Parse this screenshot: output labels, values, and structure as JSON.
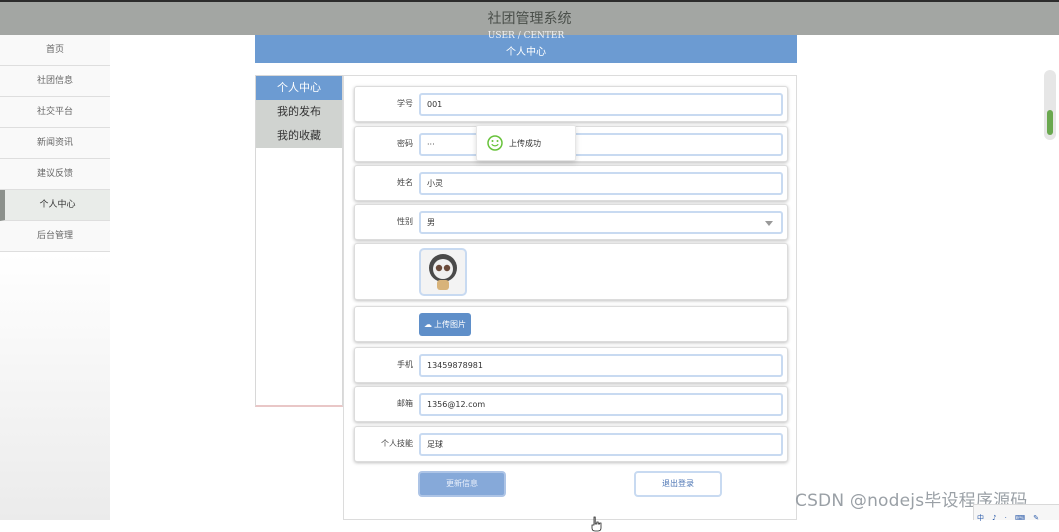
{
  "app": {
    "title": "社团管理系统"
  },
  "sidebar": {
    "items": [
      {
        "label": "首页"
      },
      {
        "label": "社团信息"
      },
      {
        "label": "社交平台"
      },
      {
        "label": "新闻资讯"
      },
      {
        "label": "建议反馈"
      },
      {
        "label": "个人中心"
      },
      {
        "label": "后台管理"
      }
    ]
  },
  "banner": {
    "en_title": "USER / CENTER",
    "cn_title": "个人中心"
  },
  "tabs": [
    {
      "label": "个人中心"
    },
    {
      "label": "我的发布"
    },
    {
      "label": "我的收藏"
    }
  ],
  "form": {
    "student_id": {
      "label": "学号",
      "value": "001"
    },
    "password": {
      "label": "密码",
      "value": "···"
    },
    "name": {
      "label": "姓名",
      "value": "小灵"
    },
    "gender": {
      "label": "性别",
      "value": "男"
    },
    "upload": {
      "label": "上传图片"
    },
    "phone": {
      "label": "手机",
      "value": "13459878981"
    },
    "email": {
      "label": "邮箱",
      "value": "1356@12.com"
    },
    "specialty": {
      "label": "个人技能",
      "value": "足球"
    },
    "update_button": "更新信息",
    "logout_button": "退出登录"
  },
  "toast": {
    "text": "上传成功",
    "icon": "smile-icon",
    "color": "#67c23a"
  },
  "colors": {
    "topbar": "#a3a6a3",
    "accent": "#6c9bd2",
    "button": "#86a9d9"
  },
  "watermark": "CSDN @nodejs毕设程序源码",
  "tray": {
    "items": [
      "中",
      "♪",
      "·",
      "⌨",
      "✎"
    ]
  }
}
